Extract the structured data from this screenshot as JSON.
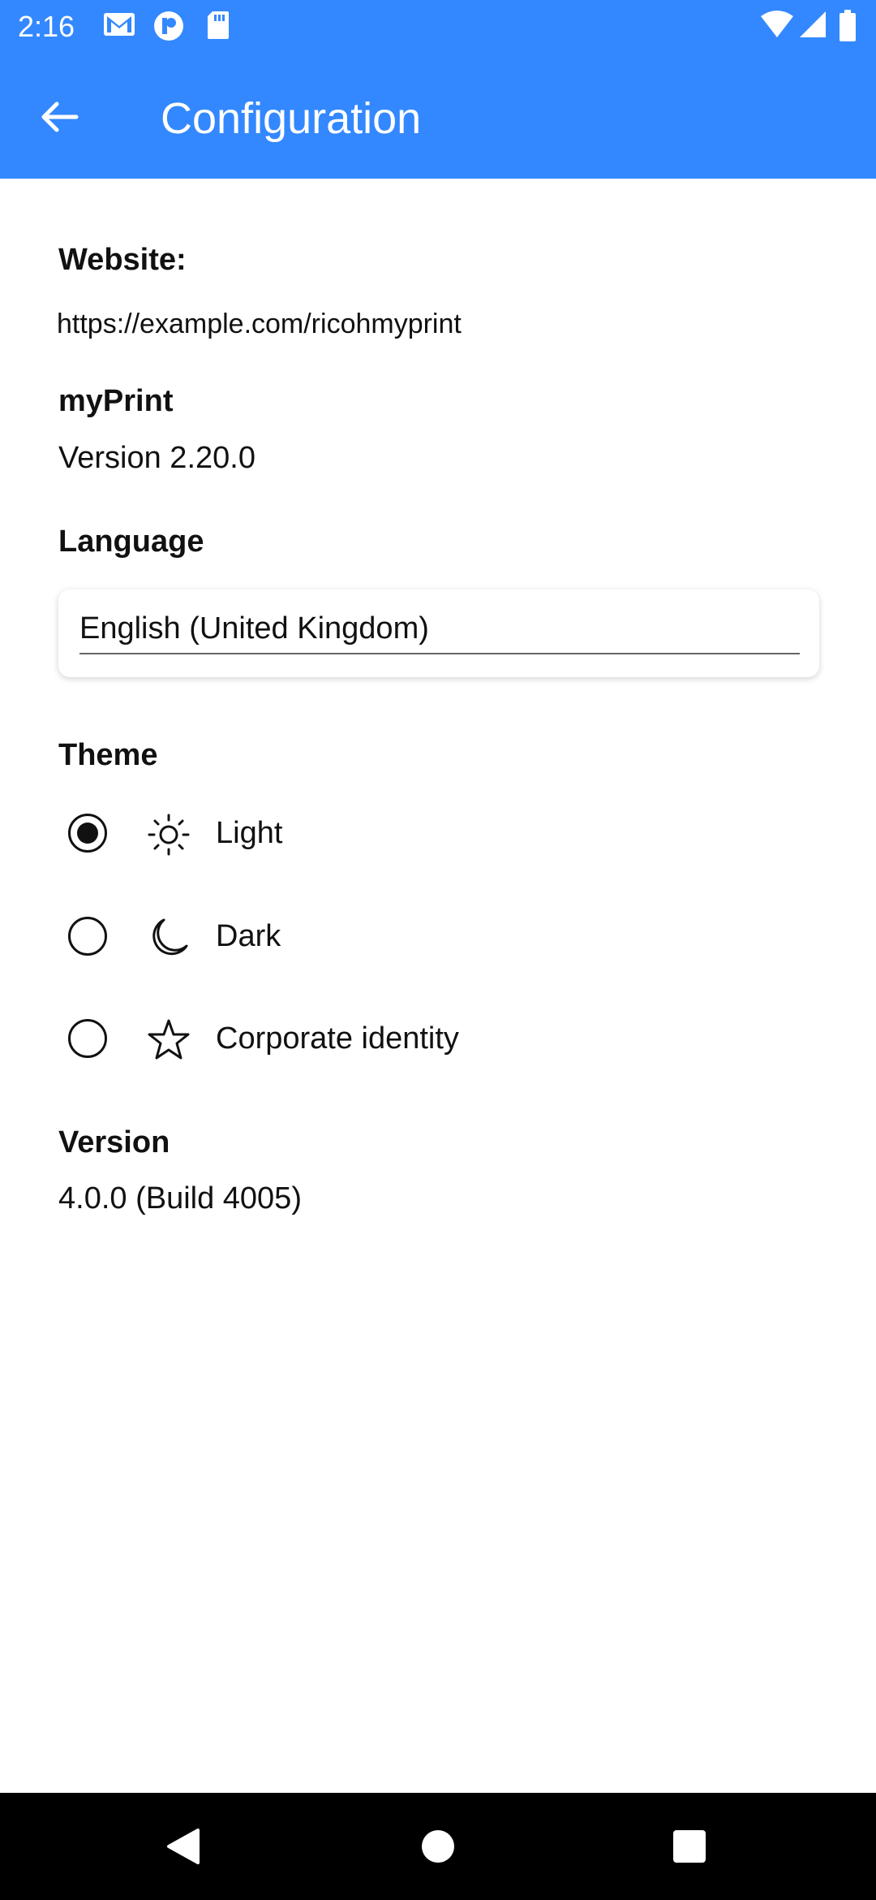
{
  "status_bar": {
    "time": "2:16",
    "icons": [
      "gmail-icon",
      "app-p-icon",
      "sd-card-icon",
      "wifi-icon",
      "signal-icon",
      "battery-icon"
    ]
  },
  "app_bar": {
    "title": "Configuration",
    "back_icon": "arrow-back-icon"
  },
  "website": {
    "label": "Website:",
    "url": "https://example.com/ricohmyprint"
  },
  "myprint": {
    "label": "myPrint",
    "version": "Version 2.20.0"
  },
  "language": {
    "label": "Language",
    "selected": "English (United Kingdom)"
  },
  "theme": {
    "label": "Theme",
    "options": [
      {
        "label": "Light",
        "icon": "sun-icon",
        "selected": true
      },
      {
        "label": "Dark",
        "icon": "moon-icon",
        "selected": false
      },
      {
        "label": "Corporate identity",
        "icon": "star-icon",
        "selected": false
      }
    ]
  },
  "version": {
    "label": "Version",
    "value": "4.0.0 (Build 4005)"
  },
  "nav_bar": {
    "buttons": [
      "back-triangle-icon",
      "home-circle-icon",
      "recents-square-icon"
    ]
  },
  "colors": {
    "primary": "#3388ff",
    "text": "#111111",
    "nav_bg": "#000000"
  }
}
